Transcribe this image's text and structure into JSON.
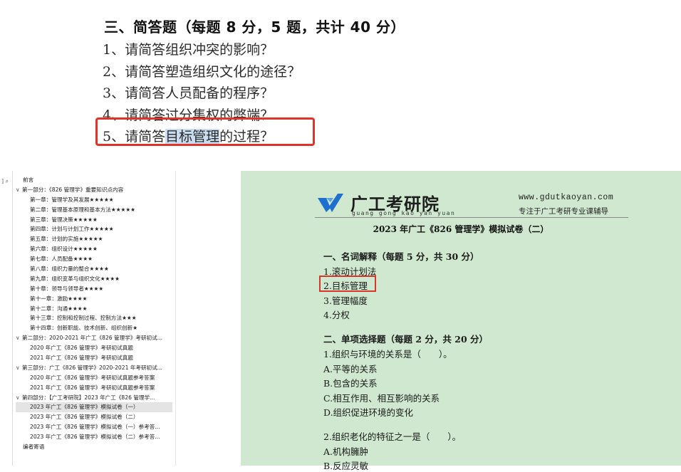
{
  "question_block": {
    "heading": "三、简答题（每题 8 分，5 题，共计 40 分）",
    "questions": [
      "1、请简答组织冲突的影响？",
      "2、请简答塑造组织文化的途径？",
      "3、请简答人员配备的程序？",
      "4、请简答过分集权的弊端？"
    ],
    "q5_prefix": "5、请简答",
    "q5_highlight": "目标管理",
    "q5_suffix": "的过程？"
  },
  "sidebar": {
    "edge_glyphs": "] ⌕",
    "toc": [
      {
        "label": "前言",
        "level": "l0",
        "chevron": ""
      },
      {
        "label": "第一部分：《826 管理学》重要知识点内容",
        "level": "l0c",
        "chevron": "∨"
      },
      {
        "label": "第一章：管理学及其发展★★★★★",
        "level": "l1",
        "chevron": ""
      },
      {
        "label": "第二章：管理基本原理和基本方法★★★★★",
        "level": "l1",
        "chevron": ""
      },
      {
        "label": "第三章：管理决策★★★★★",
        "level": "l1",
        "chevron": ""
      },
      {
        "label": "第四章：计划与计划工作★★★★★",
        "level": "l1",
        "chevron": ""
      },
      {
        "label": "第五章：计划的实施★★★★★",
        "level": "l1",
        "chevron": ""
      },
      {
        "label": "第六章：组织设计★★★★★",
        "level": "l1",
        "chevron": ""
      },
      {
        "label": "第七章：人员配备★★★★",
        "level": "l1",
        "chevron": ""
      },
      {
        "label": "第八章：组织力量的整合★★★★",
        "level": "l1",
        "chevron": ""
      },
      {
        "label": "第九章：组织变革与组织文化★★★★",
        "level": "l1",
        "chevron": ""
      },
      {
        "label": "第十章：领导与领导者★★★★",
        "level": "l1",
        "chevron": ""
      },
      {
        "label": "第十一章：激励★★★★",
        "level": "l1",
        "chevron": ""
      },
      {
        "label": "第十二章：沟通★★★★",
        "level": "l1",
        "chevron": ""
      },
      {
        "label": "第十三章：控制和控制过程、控制方法★★★",
        "level": "l1",
        "chevron": ""
      },
      {
        "label": "第十四章：创新职能、技术创新、组织创新★",
        "level": "l1",
        "chevron": ""
      },
      {
        "label": "第二部分：2020-2021 年广工《826 管理学》考研初试...",
        "level": "l0c",
        "chevron": "∨"
      },
      {
        "label": "2020 年广工《826 管理学》考研初试真题",
        "level": "l1",
        "chevron": ""
      },
      {
        "label": "2021 年广工《826 管理学》考研初试真题",
        "level": "l1",
        "chevron": ""
      },
      {
        "label": "第三部分：广工《826 管理学》2020-2021 年考研初试...",
        "level": "l0c",
        "chevron": "∨"
      },
      {
        "label": "2020 年广工《826 管理学》考研初试真题参考答案",
        "level": "l1",
        "chevron": ""
      },
      {
        "label": "2021 年广工《826 管理学》考研初试真题参考答案",
        "level": "l1",
        "chevron": ""
      },
      {
        "label": "第四部分：【广工考研院】2023 年广工《826 管理学...",
        "level": "l0c",
        "chevron": "∨"
      },
      {
        "label": "2023 年广工《826 管理学》模拟试卷（一）",
        "level": "l1",
        "chevron": "",
        "selected": true
      },
      {
        "label": "2023 年广工《826 管理学》模拟试卷（二）",
        "level": "l1",
        "chevron": ""
      },
      {
        "label": "2023 年广工《826 管理学》模拟试卷（一）参考答...",
        "level": "l1",
        "chevron": ""
      },
      {
        "label": "2023 年广工《826 管理学》模拟试卷（二）参考答...",
        "level": "l1",
        "chevron": ""
      },
      {
        "label": "编者寄语",
        "level": "l0",
        "chevron": ""
      }
    ]
  },
  "page": {
    "logo_text": "广工考研院",
    "logo_sub": "guang gong kao yan yuan",
    "site": "www.gdutkaoyan.com",
    "slogan": "专注于广工考研专业课辅导",
    "title": "2023 年广工《826 管理学》模拟试卷（二）",
    "lines": [
      {
        "text": "一、名词解释（每题 5 分，共 30 分）",
        "bold": true
      },
      {
        "text": "1.滚动计划法"
      },
      {
        "text": "2.目标管理"
      },
      {
        "text": "3.管理幅度"
      },
      {
        "text": "4.分权"
      },
      {
        "text": "二、单项选择题（每题 2 分，共 20 分）",
        "bold": true
      },
      {
        "text": "1.组织与环境的关系是（　　）。"
      },
      {
        "text": "A.平等的关系"
      },
      {
        "text": "B.包含的关系"
      },
      {
        "text": "C.相互作用、相互影响的关系"
      },
      {
        "text": "D.组织促进环境的变化"
      },
      {
        "text": "2.组织老化的特征之一是（　　）。"
      },
      {
        "text": "A.机构臃肿"
      },
      {
        "text": "B.反应灵敏"
      }
    ],
    "colors": {
      "accent_blue": "#1e6fd0",
      "highlight_box": "#d9362b",
      "page_bg": "#cfe8cf"
    }
  }
}
